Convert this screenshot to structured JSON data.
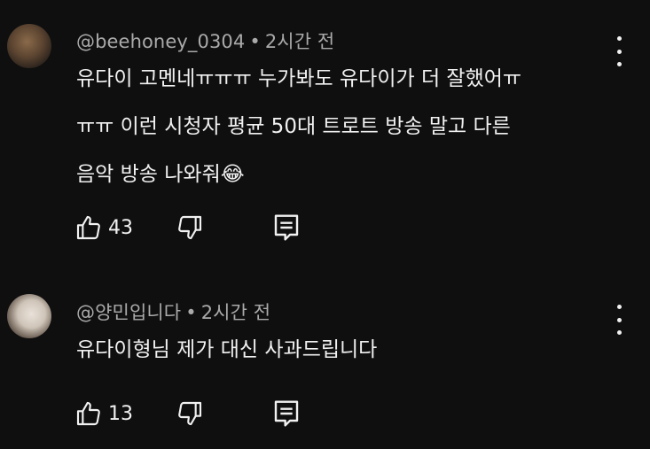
{
  "comments": [
    {
      "handle": "@beehoney_0304",
      "time": "2시간 전",
      "lines": [
        "유다이 고멘네ㅠㅠㅠ 누가봐도 유다이가 더 잘했어ㅠ",
        "ㅠㅠ 이런 시청자 평균 50대 트로트 방송 말고 다른",
        "음악 방송 나와줘😂"
      ],
      "likes": "43"
    },
    {
      "handle": "@양민입니다",
      "time": "2시간 전",
      "lines": [
        "유다이형님 제가 대신 사과드립니다"
      ],
      "likes": "13"
    }
  ],
  "separator": "•",
  "icons": {
    "like": "thumbs-up-icon",
    "dislike": "thumbs-down-icon",
    "reply": "reply-icon",
    "more": "more-vert-icon"
  }
}
